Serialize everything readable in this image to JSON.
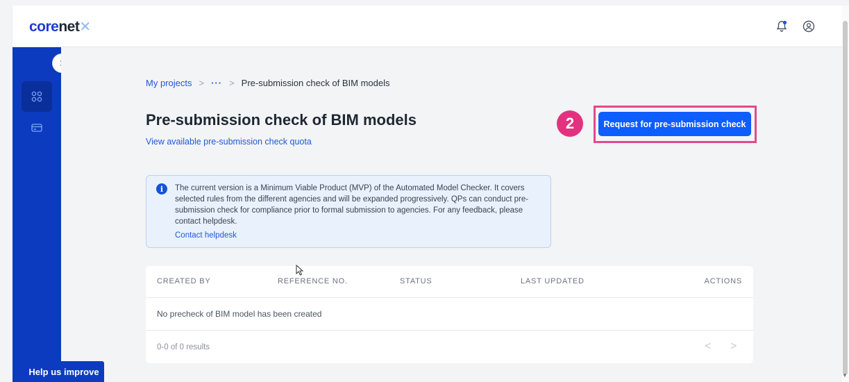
{
  "app": {
    "logo_prefix": "core",
    "logo_suffix": "net",
    "logo_mark": "✕"
  },
  "header": {
    "icons": [
      "bell-icon",
      "user-icon"
    ]
  },
  "sidebar": {
    "icons": [
      "grid-icon",
      "billing-card-icon"
    ],
    "expand_icon": "chevron-right-icon"
  },
  "help_button": {
    "label": "Help us improve"
  },
  "breadcrumb": {
    "items": [
      "My projects",
      "Pre-submission check of BIM models"
    ],
    "ellipsis": "···",
    "separator": ">"
  },
  "page": {
    "title": "Pre-submission check of BIM models",
    "quota_link": "View available pre-submission check quota"
  },
  "annotation": {
    "step": "2"
  },
  "actions": {
    "request_label": "Request for pre-submission check"
  },
  "info": {
    "text": "The current version is a Minimum Viable Product (MVP) of the Automated Model Checker. It covers selected rules from the different agencies and will be expanded progressively. QPs can conduct pre-submission check for compliance prior to formal submission to agencies. For any feedback, please contact helpdesk.",
    "link": "Contact helpdesk",
    "icon_glyph": "i"
  },
  "table": {
    "columns": [
      "CREATED BY",
      "REFERENCE NO.",
      "STATUS",
      "LAST UPDATED",
      "ACTIONS"
    ],
    "empty_message": "No precheck of BIM model has been created",
    "results": "0-0 of 0 results",
    "prev": "<",
    "next": ">"
  },
  "colors": {
    "primary": "#0d5dff",
    "sidebar": "#0c3bbf",
    "highlight": "#e2498a",
    "badge": "#e2327f",
    "link": "#1f58d6"
  }
}
